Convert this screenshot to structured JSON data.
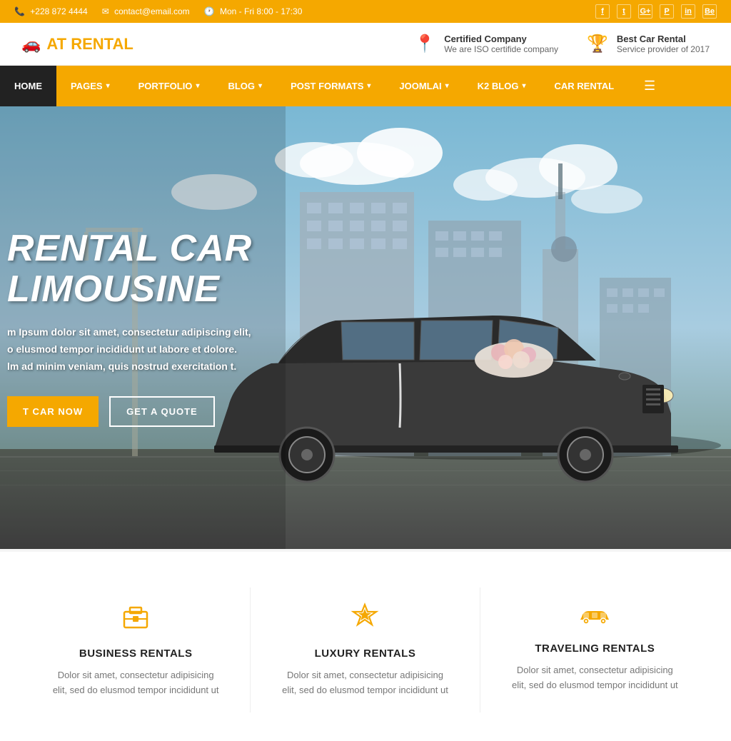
{
  "topbar": {
    "phone": "+228 872 4444",
    "email": "contact@email.com",
    "hours": "Mon - Fri 8:00 - 17:30",
    "socials": [
      "f",
      "t",
      "G+",
      "P",
      "in",
      "Be"
    ]
  },
  "header": {
    "logo_at": "AT",
    "logo_rental": "RENTAL",
    "feature1_title": "Certified Company",
    "feature1_desc": "We are ISO certifide company",
    "feature2_title": "Best Car Rental",
    "feature2_desc": "Service provider of 2017"
  },
  "nav": {
    "items": [
      {
        "label": "HOME",
        "active": true,
        "has_dropdown": false
      },
      {
        "label": "PAGES",
        "active": false,
        "has_dropdown": true
      },
      {
        "label": "PORTFOLIO",
        "active": false,
        "has_dropdown": true
      },
      {
        "label": "BLOG",
        "active": false,
        "has_dropdown": true
      },
      {
        "label": "POST FORMATS",
        "active": false,
        "has_dropdown": true
      },
      {
        "label": "JOOMLAI",
        "active": false,
        "has_dropdown": true
      },
      {
        "label": "K2 BLOG",
        "active": false,
        "has_dropdown": true
      },
      {
        "label": "CAR RENTAL",
        "active": false,
        "has_dropdown": false
      }
    ]
  },
  "hero": {
    "title": "RENTAL CAR LIMOUSINE",
    "description_line1": "m Ipsum dolor sit amet, consectetur adipiscing elit,",
    "description_line2": "o elusmod tempor incididunt ut labore et dolore.",
    "description_line3": "lm ad minim veniam, quis nostrud exercitation t.",
    "btn_rent": "T CAR NOW",
    "btn_quote": "GET A QUOTE"
  },
  "features": [
    {
      "id": "business",
      "icon": "💼",
      "title": "BUSINESS RENTALS",
      "desc": "Dolor sit amet, consectetur adipisicing elit, sed do elusmod tempor incididunt ut"
    },
    {
      "id": "luxury",
      "icon": "💎",
      "title": "LUXURY RENTALS",
      "desc": "Dolor sit amet, consectetur adipisicing elit, sed do elusmod tempor incididunt ut"
    },
    {
      "id": "traveling",
      "icon": "🚗",
      "title": "TRAVELING RENTALS",
      "desc": "Dolor sit amet, consectetur adipisicing elit, sed do elusmod tempor incididunt ut"
    }
  ],
  "colors": {
    "accent": "#f5a800",
    "dark": "#222222",
    "light_bg": "#ffffff"
  }
}
